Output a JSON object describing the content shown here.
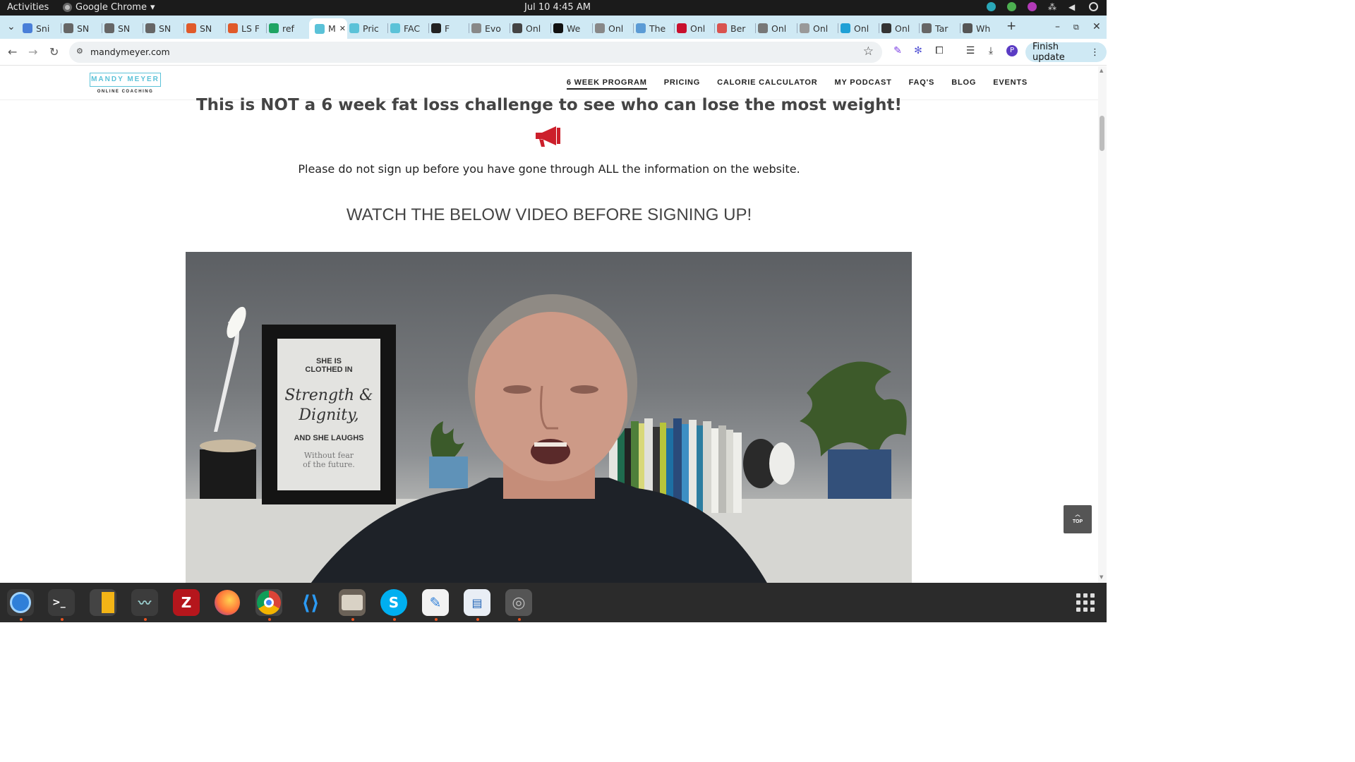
{
  "system": {
    "activities": "Activities",
    "app_name": "Google Chrome",
    "clock": "Jul 10  4:45 AM"
  },
  "tabs": [
    {
      "label": "Sni",
      "color": "#4a7fd8"
    },
    {
      "label": "SN",
      "color": "#666"
    },
    {
      "label": "SN",
      "color": "#666"
    },
    {
      "label": "SN",
      "color": "#666"
    },
    {
      "label": "SN",
      "color": "#e05a2a"
    },
    {
      "label": "LS F",
      "color": "#e05a2a"
    },
    {
      "label": "ref",
      "color": "#1fa463"
    },
    {
      "label": "M",
      "color": "#5bc2d8"
    },
    {
      "label": "Pric",
      "color": "#5bc2d8"
    },
    {
      "label": "FAC",
      "color": "#5bc2d8"
    },
    {
      "label": "F",
      "color": "#222"
    },
    {
      "label": "Evo",
      "color": "#888"
    },
    {
      "label": "Onl",
      "color": "#444"
    },
    {
      "label": "We",
      "color": "#111"
    },
    {
      "label": "Onl",
      "color": "#888"
    },
    {
      "label": "The",
      "color": "#5b9bd5"
    },
    {
      "label": "Onl",
      "color": "#c8102e"
    },
    {
      "label": "Ber",
      "color": "#d9534f"
    },
    {
      "label": "Onl",
      "color": "#777"
    },
    {
      "label": "Onl",
      "color": "#999"
    },
    {
      "label": "Onl",
      "color": "#1ea0d6"
    },
    {
      "label": "Onl",
      "color": "#333"
    },
    {
      "label": "Tar",
      "color": "#666"
    },
    {
      "label": "Wh",
      "color": "#555"
    }
  ],
  "toolbar": {
    "url": "mandymeyer.com",
    "finish_update": "Finish update",
    "profile_initial": "P"
  },
  "site": {
    "logo_name": "MANDY MEYER",
    "logo_sub": "ONLINE COACHING",
    "nav": [
      "6 WEEK PROGRAM",
      "PRICING",
      "CALORIE CALCULATOR",
      "MY PODCAST",
      "FAQ'S",
      "BLOG",
      "EVENTS"
    ],
    "headline": "This is NOT a 6 week fat loss challenge to see who can lose the most weight!",
    "notice": "Please do not sign up before you have gone through ALL the information on the website.",
    "watch": "WATCH THE BELOW VIDEO BEFORE SIGNING UP!",
    "frame_text": [
      "SHE IS",
      "CLOTHED IN",
      "Strength &",
      "Dignity,",
      "AND SHE LAUGHS",
      "Without fear",
      "of the future."
    ],
    "top_button": "TOP",
    "accent": "#5bc2d8",
    "megaphone_color": "#cc1f2b"
  },
  "dock": [
    "Thunderbird",
    "Terminal",
    "Calculator",
    "System Monitor",
    "FileZilla",
    "Firefox",
    "Chrome",
    "VS Code",
    "Files",
    "Skype",
    "Text Editor",
    "Document Viewer",
    "Disks"
  ]
}
